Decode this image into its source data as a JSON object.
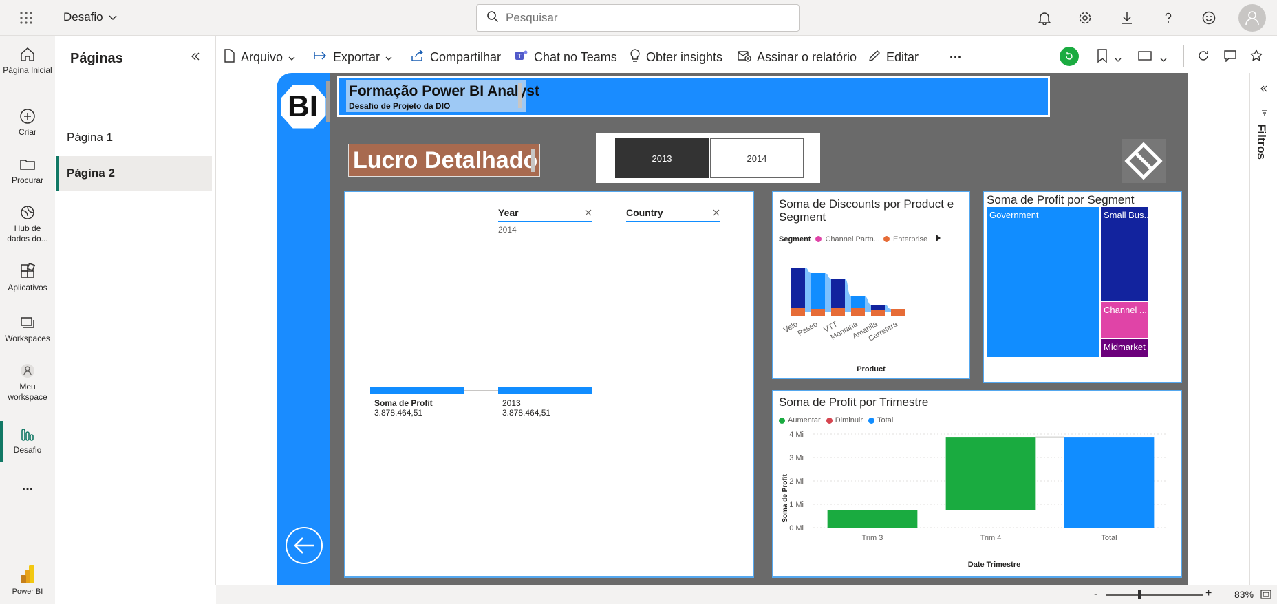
{
  "app": {
    "workspace_name": "Desafio",
    "search_placeholder": "Pesquisar",
    "brand": "Power BI"
  },
  "left_nav": [
    {
      "label": "Página Inicial",
      "icon": "home-icon"
    },
    {
      "label": "Criar",
      "icon": "plus-circle-icon"
    },
    {
      "label": "Procurar",
      "icon": "folder-icon"
    },
    {
      "label": "Hub de dados do...",
      "icon": "data-hub-icon"
    },
    {
      "label": "Aplicativos",
      "icon": "apps-icon"
    },
    {
      "label": "Workspaces",
      "icon": "workspaces-icon"
    },
    {
      "label": "Meu workspace",
      "icon": "person-workspace-icon"
    },
    {
      "label": "Desafio",
      "icon": "report-bars-icon"
    },
    {
      "label": "...",
      "icon": "more-icon"
    }
  ],
  "pages_panel": {
    "title": "Páginas",
    "pages": [
      "Página 1",
      "Página 2"
    ],
    "active": "Página 2"
  },
  "toolbar": {
    "arquivo": "Arquivo",
    "exportar": "Exportar",
    "compartilhar": "Compartilhar",
    "chat_teams": "Chat no Teams",
    "obter_insights": "Obter insights",
    "assinar": "Assinar o relatório",
    "editar": "Editar",
    "more": "···"
  },
  "filters_pane": {
    "label": "Filtros"
  },
  "report": {
    "logo_text": "BI",
    "header_title": "Formação Power BI Analyst",
    "header_subtitle": "Desafio de Projeto da DIO",
    "page_title": "Lucro Detalhado",
    "year_slicer": [
      "2013",
      "2014"
    ],
    "slicer_year_label": "Year",
    "slicer_year_value": "2014",
    "slicer_country_label": "Country",
    "kpi_left_label": "Soma de Profit",
    "kpi_left_value": "3.878.464,51",
    "kpi_right_label": "2013",
    "kpi_right_value": "3.878.464,51"
  },
  "colors": {
    "accent": "#118dff",
    "header_blue": "#1a8cff",
    "title_bar": "#a86a4f",
    "green": "#1aab40",
    "red": "#d64550",
    "pink": "#e044a7",
    "navy": "#12239e",
    "purple": "#6b007b",
    "orange": "#e66c37"
  },
  "chart_data": [
    {
      "type": "area",
      "title": "Soma de Discounts por Product e Segment",
      "legend_title": "Segment",
      "legend": [
        "Channel Partn...",
        "Enterprise"
      ],
      "xlabel": "Product",
      "categories": [
        "Velo",
        "Paseo",
        "VTT",
        "Montana",
        "Amarilla",
        "Carretera"
      ]
    },
    {
      "type": "heatmap",
      "title": "Soma de Profit por Segment",
      "segments": [
        {
          "name": "Government",
          "share": 0.61,
          "color": "#118dff"
        },
        {
          "name": "Small Bus...",
          "share": 0.21,
          "color": "#12239e"
        },
        {
          "name": "Channel ...",
          "share": 0.08,
          "color": "#e044a7"
        },
        {
          "name": "Midmarket",
          "share": 0.04,
          "color": "#6b007b"
        }
      ]
    },
    {
      "type": "bar",
      "title": "Soma de Profit por Trimestre",
      "legend": [
        "Aumentar",
        "Diminuir",
        "Total"
      ],
      "categories": [
        "Trim 3",
        "Trim 4",
        "Total"
      ],
      "start": [
        0,
        0.75,
        0
      ],
      "end": [
        0.75,
        3.88,
        3.88
      ],
      "kind": [
        "Aumentar",
        "Aumentar",
        "Total"
      ],
      "xlabel": "Date Trimestre",
      "ylabel": "Soma de Profit",
      "yticks": [
        "0 Mi",
        "1 Mi",
        "2 Mi",
        "3 Mi",
        "4 Mi"
      ],
      "ylim": [
        0,
        4
      ]
    }
  ],
  "statusbar": {
    "zoom": "83%",
    "minus": "-",
    "plus": "+"
  }
}
